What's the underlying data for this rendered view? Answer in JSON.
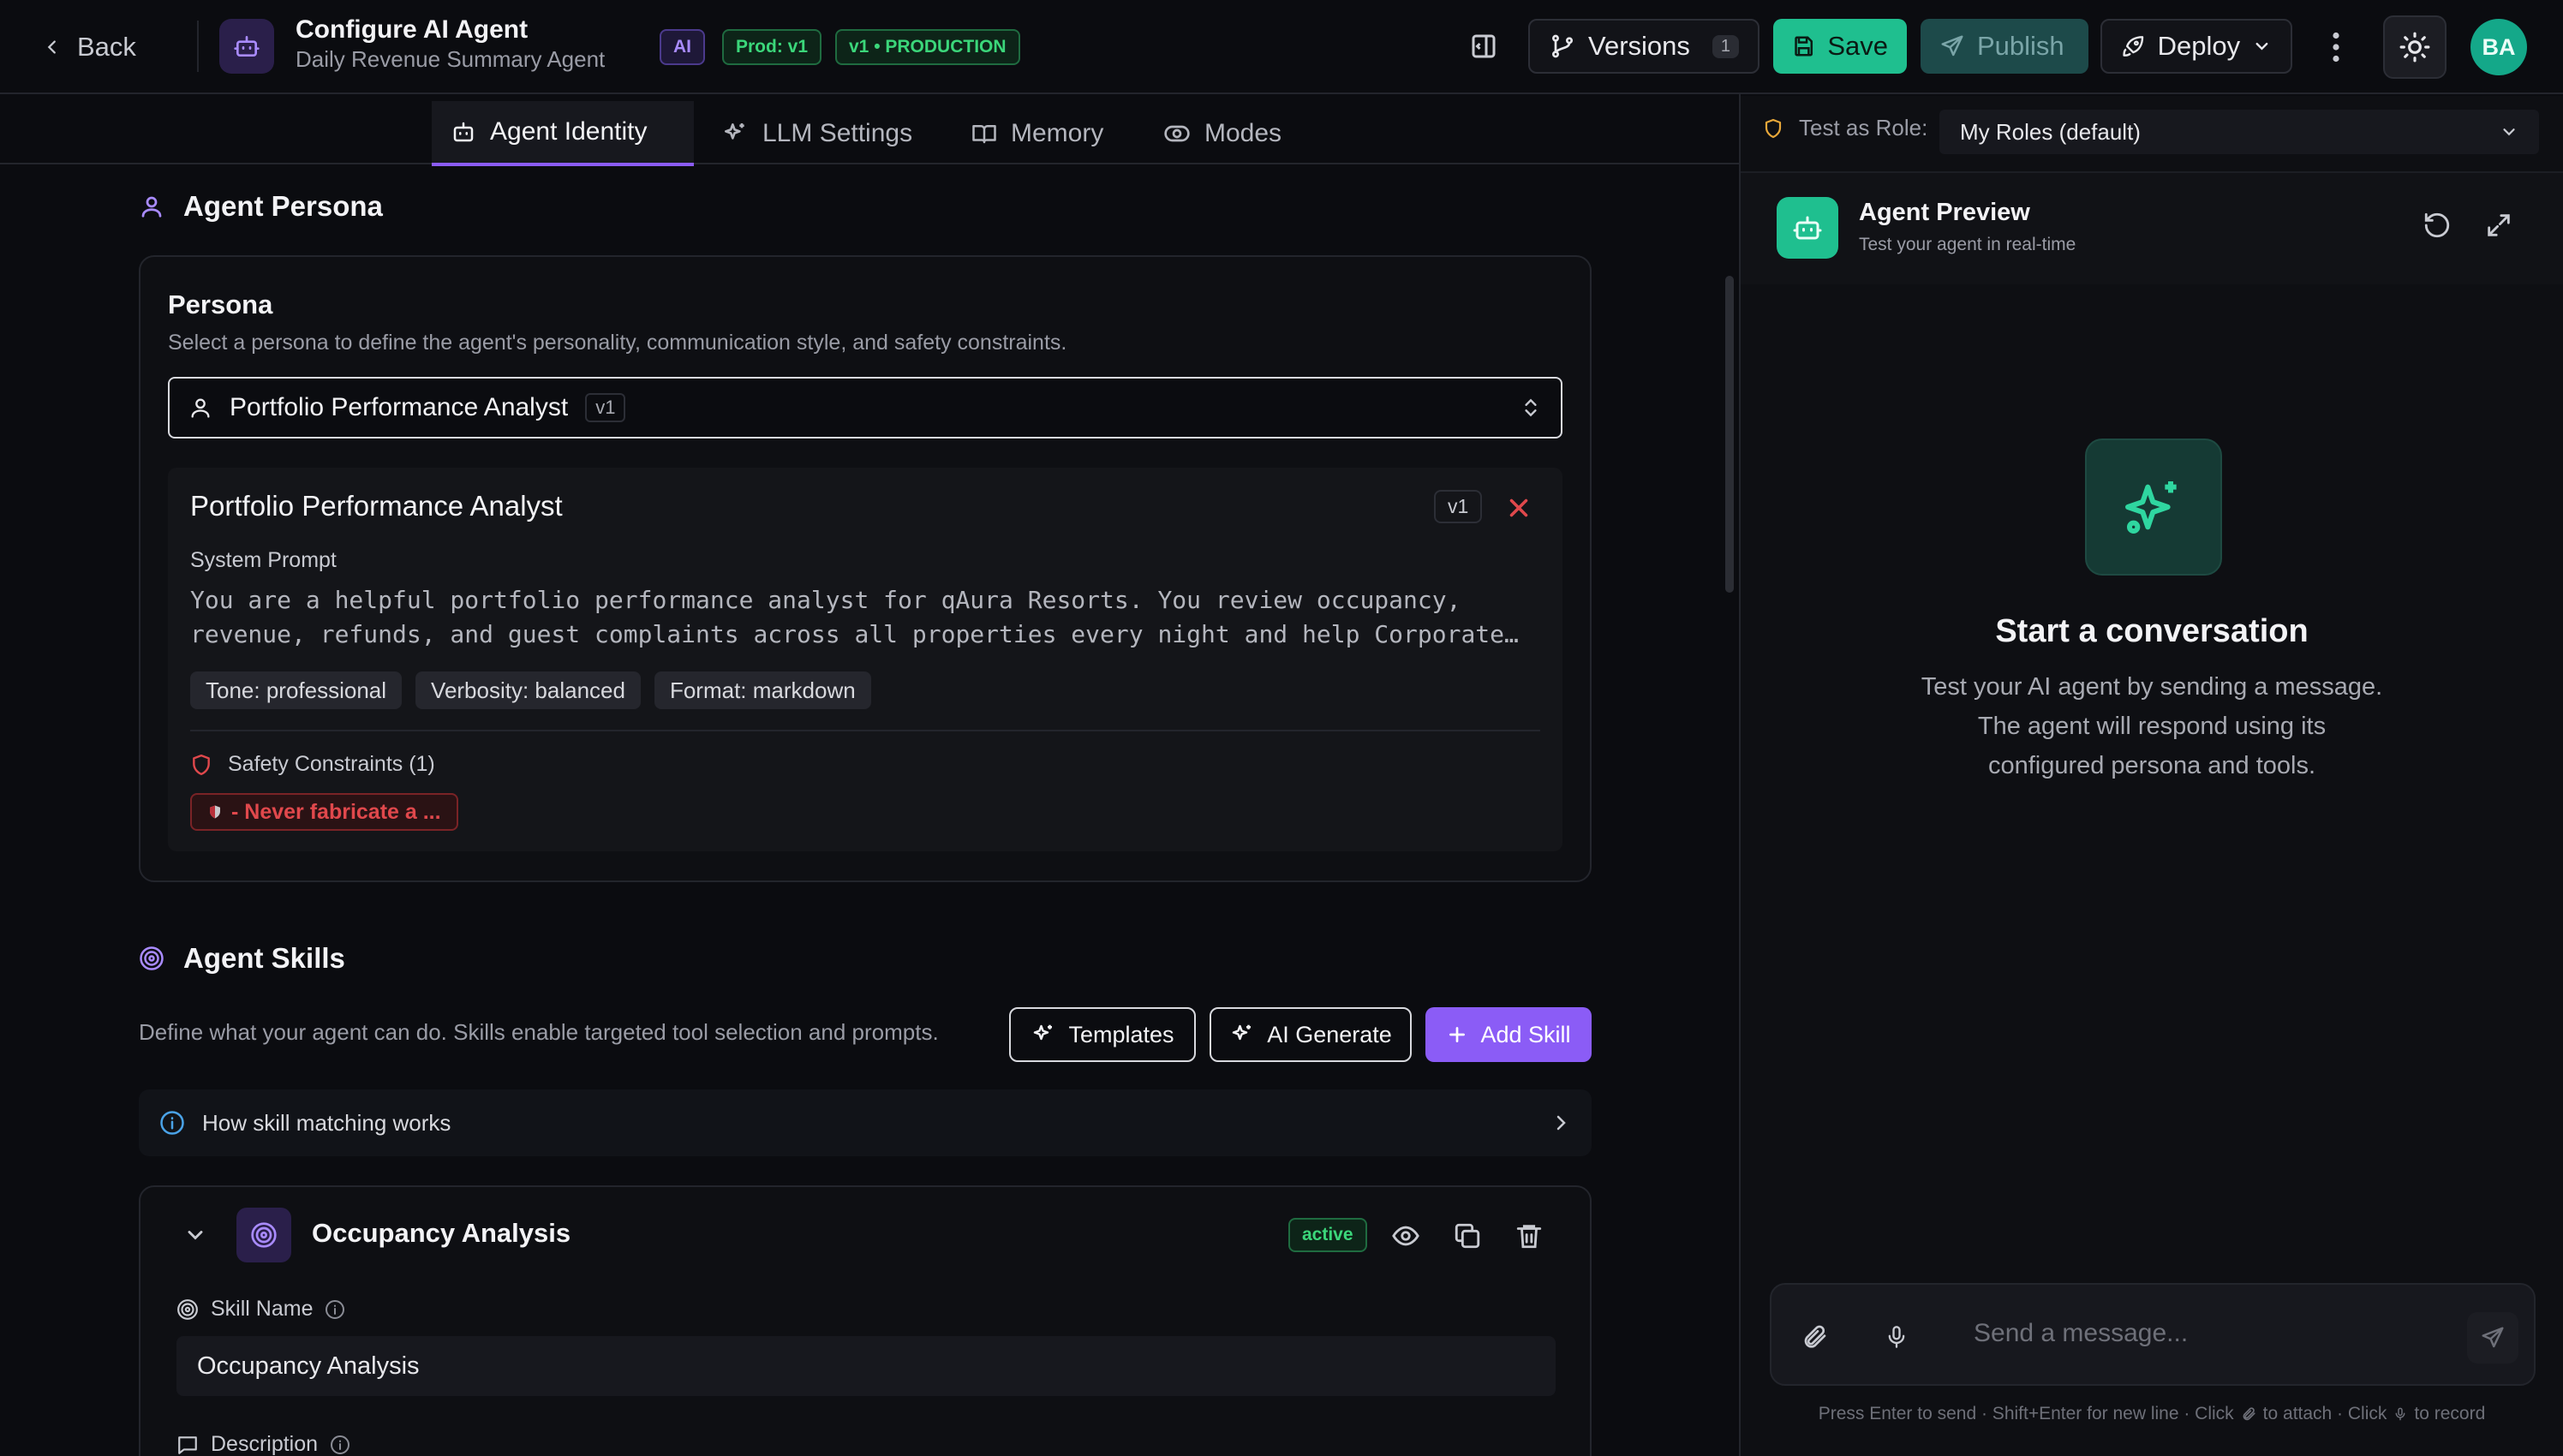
{
  "header": {
    "back_label": "Back",
    "title": "Configure AI Agent",
    "subtitle": "Daily Revenue Summary Agent",
    "badges": {
      "ai": "AI",
      "prod": "Prod: v1",
      "version": "v1 • PRODUCTION"
    },
    "versions_label": "Versions",
    "versions_count": "1",
    "save_label": "Save",
    "publish_label": "Publish",
    "deploy_label": "Deploy",
    "avatar_initials": "BA"
  },
  "tabs": [
    "Agent Identity",
    "LLM Settings",
    "Memory",
    "Modes"
  ],
  "persona_section": {
    "title": "Agent Persona",
    "card_title": "Persona",
    "card_desc": "Select a persona to define the agent's personality, communication style, and safety constraints.",
    "selected": "Portfolio Performance Analyst",
    "selected_version": "v1",
    "detail": {
      "name": "Portfolio Performance Analyst",
      "version": "v1",
      "prompt_label": "System Prompt",
      "prompt_line1": "You are a helpful portfolio performance analyst for qAura Resorts. You review occupancy,",
      "prompt_line2": "revenue, refunds, and guest complaints across all properties every night and help Corporate…",
      "tags": [
        "Tone: professional",
        "Verbosity: balanced",
        "Format: markdown"
      ],
      "safety_label": "Safety Constraints (1)",
      "safety_item": "- Never fabricate a ..."
    }
  },
  "skills_section": {
    "title": "Agent Skills",
    "desc": "Define what your agent can do. Skills enable targeted tool selection and prompts.",
    "templates_label": "Templates",
    "ai_generate_label": "AI Generate",
    "add_skill_label": "Add Skill",
    "how_label": "How skill matching works",
    "skill": {
      "name": "Occupancy Analysis",
      "status": "active",
      "name_label": "Skill Name",
      "name_value": "Occupancy Analysis",
      "description_label": "Description"
    }
  },
  "preview": {
    "role_label": "Test as Role:",
    "role_value": "My Roles (default)",
    "title": "Agent Preview",
    "subtitle": "Test your agent in real-time",
    "empty_title": "Start a conversation",
    "empty_line1": "Test your AI agent by sending a message.",
    "empty_line2": "The agent will respond using its",
    "empty_line3": "configured persona and tools.",
    "input_placeholder": "Send a message...",
    "hint_a": "Press Enter to send · Shift+Enter for new line · Click",
    "hint_b": "to attach · Click",
    "hint_c": "to record"
  },
  "colors": {
    "accent": "#8b5cf6",
    "brand_green": "#1fbf8f",
    "danger": "#e0484c"
  },
  "icons": [
    "chevron-left-icon",
    "robot-icon",
    "sidebar-toggle-icon",
    "git-branch-icon",
    "save-icon",
    "send-icon",
    "rocket-icon",
    "chevron-down-icon",
    "more-vertical-icon",
    "sun-icon",
    "user-icon",
    "sparkles-icon",
    "book-icon",
    "eye-icon",
    "shield-icon",
    "chevrons-updown-icon",
    "close-icon",
    "target-icon",
    "plus-icon",
    "info-icon",
    "chevron-right-icon",
    "copy-icon",
    "trash-icon",
    "refresh-icon",
    "maximize-icon",
    "paperclip-icon",
    "microphone-icon",
    "message-square-icon"
  ]
}
